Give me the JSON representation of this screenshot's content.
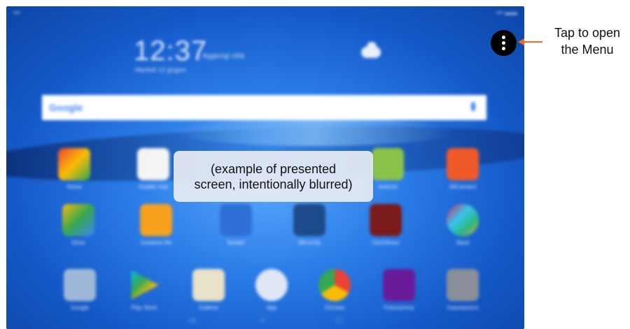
{
  "overlay_note": "(example of presented\nscreen, intentionally blurred)",
  "menu_hint": "Tap to open\nthe Menu",
  "colors": {
    "arrow": "#f26a1b",
    "menu_button": "#000000",
    "overlay_bg": "#e8ecf4"
  },
  "icons": {
    "menu_button": "more-vertical-icon",
    "weather": "weather-cloud-icon",
    "mic": "mic-icon",
    "search_logo": "google-logo-icon"
  }
}
